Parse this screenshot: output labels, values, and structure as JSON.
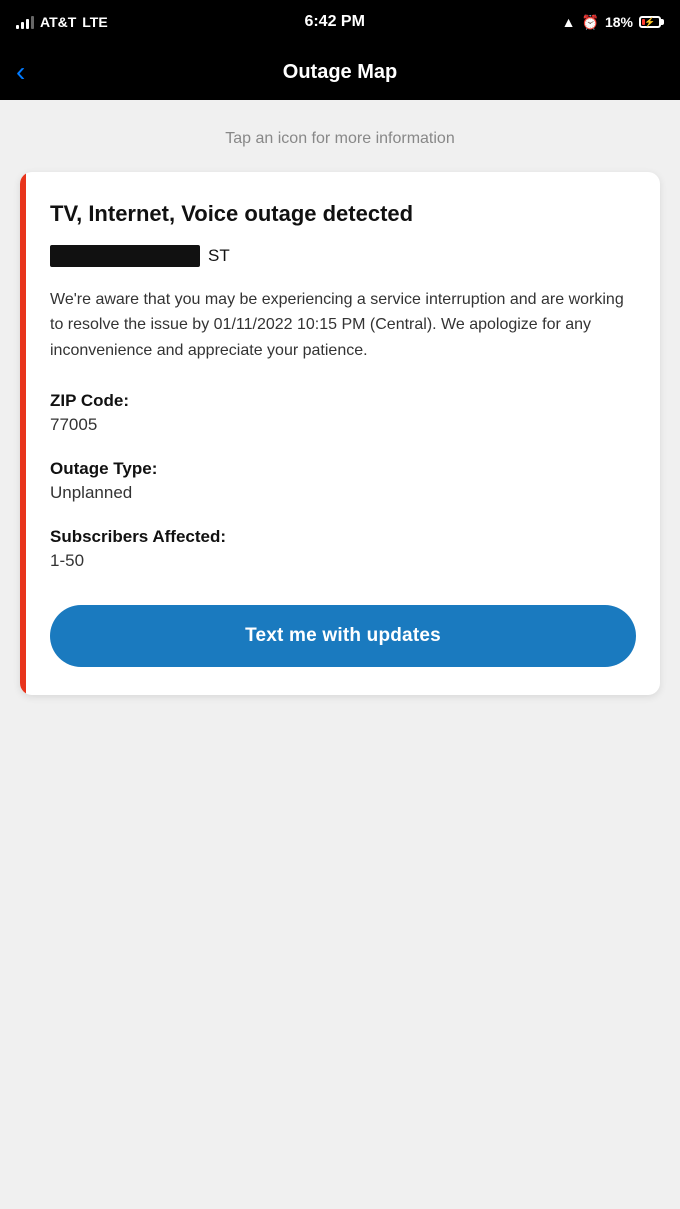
{
  "status_bar": {
    "carrier": "AT&T",
    "network": "LTE",
    "time": "6:42 PM",
    "battery_percent": "18%",
    "charging": true
  },
  "nav": {
    "back_label": "‹",
    "title": "Outage Map"
  },
  "hint": {
    "text": "Tap an icon for more information"
  },
  "card": {
    "accent_color": "#e8341c",
    "title": "TV, Internet, Voice outage detected",
    "address_suffix": "ST",
    "description": "We're aware that you may be experiencing a service interruption and are working to resolve the issue by 01/11/2022 10:15 PM (Central). We apologize for any inconvenience and appreciate your patience.",
    "zip_code_label": "ZIP Code:",
    "zip_code_value": "77005",
    "outage_type_label": "Outage Type:",
    "outage_type_value": "Unplanned",
    "subscribers_label": "Subscribers Affected:",
    "subscribers_value": "1-50",
    "button_label": "Text me with updates",
    "button_color": "#1a7abf"
  }
}
